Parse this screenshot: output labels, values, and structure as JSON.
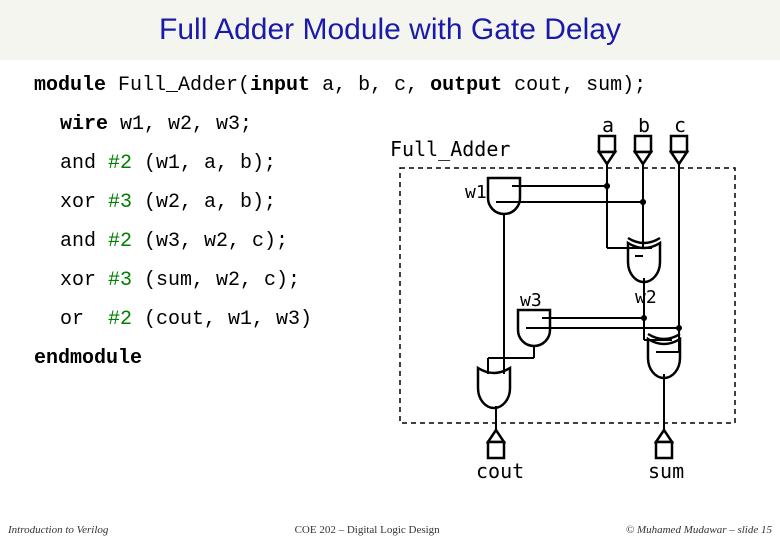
{
  "title": "Full Adder Module with Gate Delay",
  "code": {
    "module_decl": "module Full_Adder(input a, b, c, output cout, sum);",
    "wire_decl": "wire w1, w2, w3;",
    "l1_gate": "and ",
    "l1_delay": "#2",
    "l1_args": " (w1, a, b);",
    "l2_gate": "xor ",
    "l2_delay": "#3",
    "l2_args": " (w2, a, b);",
    "l3_gate": "and ",
    "l3_delay": "#2",
    "l3_args": " (w3, w2, c);",
    "l4_gate": "xor ",
    "l4_delay": "#3",
    "l4_args": " (sum, w2, c);",
    "l5_gate": "or  ",
    "l5_delay": "#2",
    "l5_args": " (cout, w1, w3)",
    "endmodule": "endmodule"
  },
  "diagram": {
    "module_label": "Full_Adder",
    "in_a": "a",
    "in_b": "b",
    "in_c": "c",
    "w1": "w1",
    "w2": "w2",
    "w3": "w3",
    "cout": "cout",
    "sum": "sum"
  },
  "footer": {
    "left": "Introduction to Verilog",
    "mid": "COE 202 – Digital Logic Design",
    "right": "© Muhamed Mudawar – slide 15"
  }
}
